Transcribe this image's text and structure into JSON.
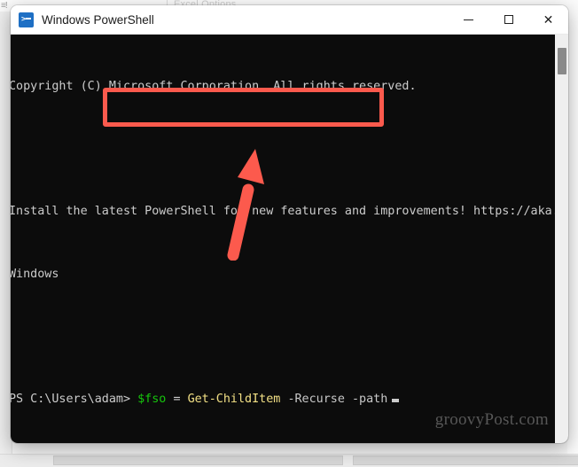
{
  "background_app": {
    "dialog_title": "Excel Options",
    "left_icon_glyph": "≡!"
  },
  "window": {
    "title": "Windows PowerShell",
    "icon_name": "powershell-icon",
    "icon_glyph": ">",
    "controls": {
      "minimize_label": "–",
      "maximize_label": "□",
      "close_label": "✕"
    }
  },
  "console": {
    "lines": [
      {
        "id": "copyright",
        "segments": [
          {
            "text": "Copyright (C) Microsoft Corporation. All rights reserved.",
            "color": "gray"
          }
        ]
      },
      {
        "id": "blank1",
        "segments": [
          {
            "text": " ",
            "color": "gray"
          }
        ]
      },
      {
        "id": "install-notice",
        "segments": [
          {
            "text": "Install the latest PowerShell for new features and improvements! https://aka.ms/PS",
            "color": "gray"
          }
        ]
      },
      {
        "id": "install-notice-wrap",
        "segments": [
          {
            "text": "Windows",
            "color": "gray"
          }
        ]
      },
      {
        "id": "blank2",
        "segments": [
          {
            "text": " ",
            "color": "gray"
          }
        ]
      }
    ],
    "prompt": "PS C:\\Users\\adam>",
    "command": {
      "variable": "$fso",
      "operator": "=",
      "cmdlet": "Get-ChildItem",
      "param_recurse": "-Recurse",
      "param_path": "-path"
    },
    "cursor": "_"
  },
  "annotations": {
    "highlight_box_color": "#fc5a4d",
    "arrow_color": "#fc5a4d",
    "highlight_target": "command-line"
  },
  "watermark": {
    "text": "groovyPost.com"
  }
}
